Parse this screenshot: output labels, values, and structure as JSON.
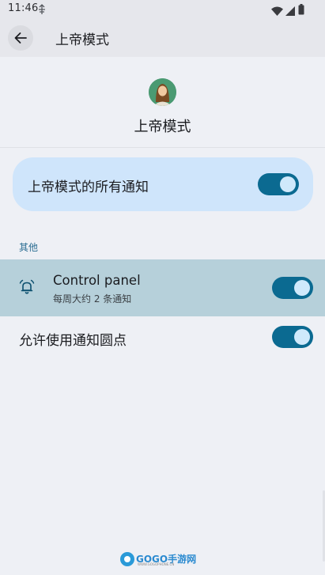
{
  "status_bar": {
    "time": "11:46",
    "icons": [
      "usb-debug-icon",
      "wifi-icon",
      "cellular-signal-icon",
      "battery-icon"
    ]
  },
  "app_bar": {
    "back_icon": "arrow-back-icon",
    "title": "上帝模式"
  },
  "header": {
    "app_icon": "app-avatar-icon",
    "app_name": "上帝模式"
  },
  "main_toggle": {
    "label": "上帝模式的所有通知",
    "enabled": true
  },
  "section": {
    "title": "其他"
  },
  "channels": [
    {
      "icon": "bell-icon",
      "title": "Control panel",
      "subtitle": "每周大约 2 条通知",
      "enabled": true
    }
  ],
  "notification_dot": {
    "label": "允许使用通知圆点",
    "enabled": true
  },
  "watermark": {
    "brand": "GOGO手游网",
    "sub": "WWW.GOGOPHONE.CN"
  },
  "colors": {
    "toggle_track": "#0b6a91",
    "toggle_knob": "#cfe9fb",
    "card_background": "#cfe5fb",
    "highlight_row": "#b6d0da",
    "section_header": "#2a6d92",
    "page_background": "#eef0f5"
  }
}
